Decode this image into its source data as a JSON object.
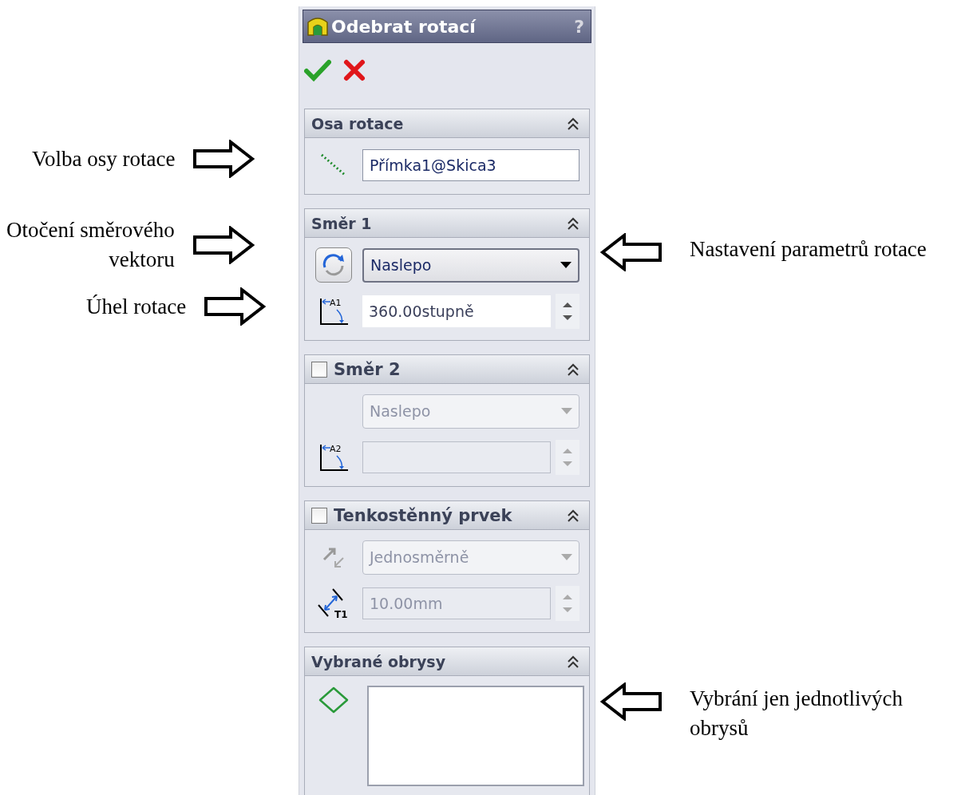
{
  "panel": {
    "title": "Odebrat rotací",
    "help": "?"
  },
  "sections": [
    {
      "title": "Osa rotace",
      "rows": [
        {
          "kind": "axis",
          "value": "Přímka1@Skica3",
          "disabled": false
        }
      ]
    },
    {
      "title": "Směr 1",
      "rows": [
        {
          "kind": "reverse-dropdown",
          "value": "Naslepo",
          "disabled": false
        },
        {
          "kind": "angle",
          "icon_label": "A1",
          "value": "360.00stupně",
          "disabled": false
        }
      ]
    },
    {
      "title": "Směr 2",
      "checkbox": {
        "checked": false
      },
      "rows": [
        {
          "kind": "dropdown",
          "value": "Naslepo",
          "disabled": true
        },
        {
          "kind": "angle",
          "icon_label": "A2",
          "disabled": true
        }
      ]
    },
    {
      "title": "Tenkostěnný prvek",
      "checkbox": {
        "checked": false
      },
      "rows": [
        {
          "kind": "thin-dropdown",
          "value": "Jednosměrně",
          "disabled": true
        },
        {
          "kind": "thickness",
          "icon_label": "T1",
          "value": "10.00mm",
          "disabled": true
        }
      ]
    },
    {
      "title": "Vybrané obrysy",
      "rows": [
        {
          "kind": "contours"
        }
      ]
    }
  ],
  "callouts": [
    {
      "kind": "left",
      "lines": [
        "Volba osy rotace"
      ]
    },
    {
      "kind": "left",
      "lines": [
        "Otočení směrového",
        "vektoru"
      ]
    },
    {
      "kind": "left",
      "lines": [
        "Úhel rotace"
      ]
    },
    {
      "kind": "right",
      "lines": [
        "Nastavení parametrů rotace"
      ]
    },
    {
      "kind": "right",
      "lines": [
        "Vybrání jen jednotlivých",
        "obrysů"
      ]
    }
  ]
}
